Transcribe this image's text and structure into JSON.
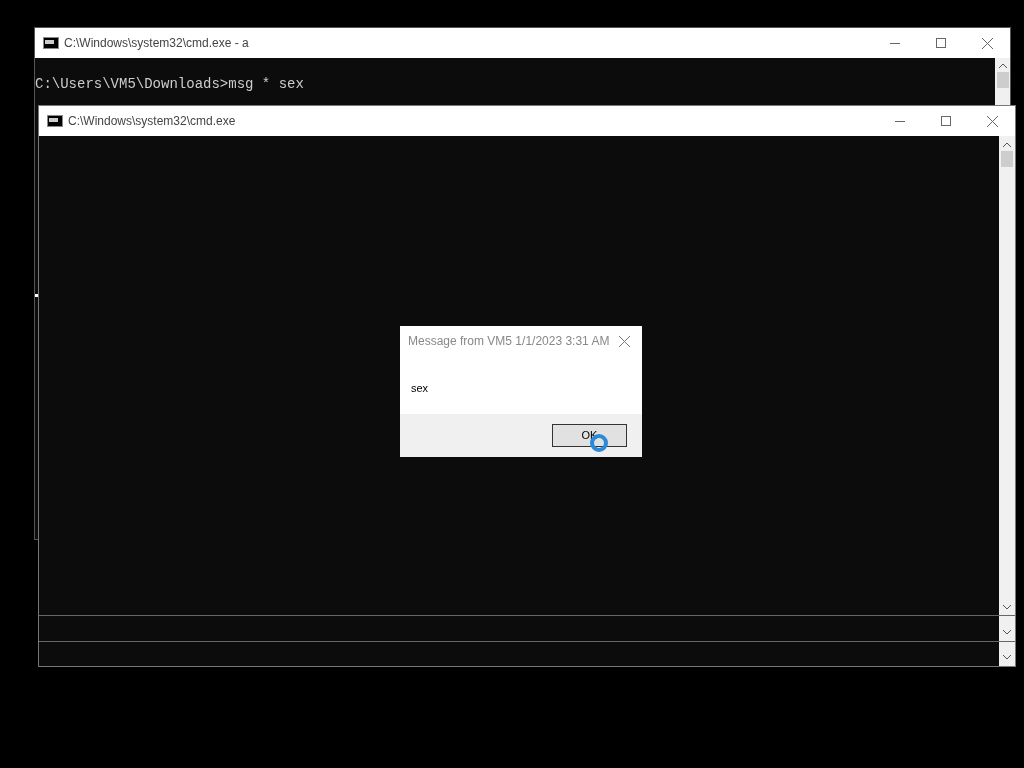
{
  "back_window": {
    "title": "C:\\Windows\\system32\\cmd.exe - a",
    "console_lines": [
      "C:\\Users\\VM5\\Downloads>msg * sex"
    ]
  },
  "front_window": {
    "title": "C:\\Windows\\system32\\cmd.exe"
  },
  "dialog": {
    "title": "Message from VM5 1/1/2023 3:31 AM",
    "message": "sex",
    "buttons": [
      "OK"
    ]
  }
}
